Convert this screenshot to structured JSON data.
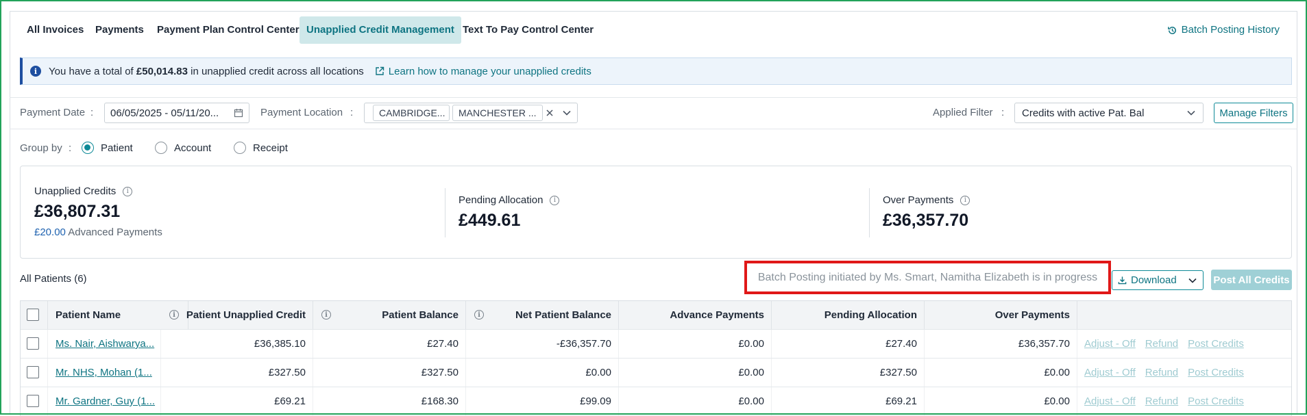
{
  "tabs": [
    {
      "label": "All Invoices",
      "active": false
    },
    {
      "label": "Payments",
      "active": false
    },
    {
      "label": "Payment Plan Control Center",
      "active": false
    },
    {
      "label": "Unapplied Credit Management",
      "active": true
    },
    {
      "label": "Text To Pay Control Center",
      "active": false
    }
  ],
  "batch_history_label": "Batch Posting History",
  "banner": {
    "prefix": "You have a total of",
    "amount": "£50,014.83",
    "suffix": "in unapplied credit across all locations",
    "link": "Learn how to manage your unapplied credits"
  },
  "filters": {
    "payment_date_label": "Payment Date",
    "payment_date_value": "06/05/2025 - 05/11/20...",
    "payment_location_label": "Payment Location",
    "locations": [
      "CAMBRIDGE...",
      "MANCHESTER ..."
    ],
    "applied_filter_label": "Applied Filter",
    "applied_filter_value": "Credits with active Pat. Bal",
    "manage_filters": "Manage Filters",
    "colon": ":"
  },
  "group_by": {
    "label": "Group by",
    "options": [
      "Patient",
      "Account",
      "Receipt"
    ],
    "selected": "Patient"
  },
  "summary": {
    "unapplied_title": "Unapplied Credits",
    "unapplied_value": "£36,807.31",
    "advanced_amount": "£20.00",
    "advanced_label": "Advanced Payments",
    "pending_title": "Pending Allocation",
    "pending_value": "£449.61",
    "over_title": "Over Payments",
    "over_value": "£36,357.70"
  },
  "toolbar": {
    "all_patients": "All Patients (6)",
    "batch_message": "Batch Posting initiated by Ms. Smart, Namitha Elizabeth is in progress",
    "download": "Download",
    "post_all": "Post All Credits"
  },
  "table": {
    "headers": {
      "patient_name": "Patient Name",
      "unapplied_credit": "Patient Unapplied Credit",
      "patient_balance": "Patient Balance",
      "net_balance": "Net Patient Balance",
      "advance_payments": "Advance Payments",
      "pending_allocation": "Pending Allocation",
      "over_payments": "Over Payments"
    },
    "actions": [
      "Adjust - Off",
      "Refund",
      "Post Credits"
    ],
    "rows": [
      {
        "name": "Ms. Nair, Aishwarya...",
        "credit": "£36,385.10",
        "balance": "£27.40",
        "net": "-£36,357.70",
        "advance": "£0.00",
        "pending": "£27.40",
        "over": "£36,357.70"
      },
      {
        "name": "Mr. NHS, Mohan (1...",
        "credit": "£327.50",
        "balance": "£327.50",
        "net": "£0.00",
        "advance": "£0.00",
        "pending": "£327.50",
        "over": "£0.00"
      },
      {
        "name": "Mr. Gardner, Guy (1...",
        "credit": "£69.21",
        "balance": "£168.30",
        "net": "£99.09",
        "advance": "£0.00",
        "pending": "£69.21",
        "over": "£0.00"
      }
    ]
  },
  "colors": {
    "accent": "#0e7482",
    "active_tab_bg": "#cfe8ea",
    "banner_bg": "#edf4fb",
    "banner_border": "#1e4fa0",
    "highlight_box": "#e01818",
    "frame": "#22a35a"
  }
}
